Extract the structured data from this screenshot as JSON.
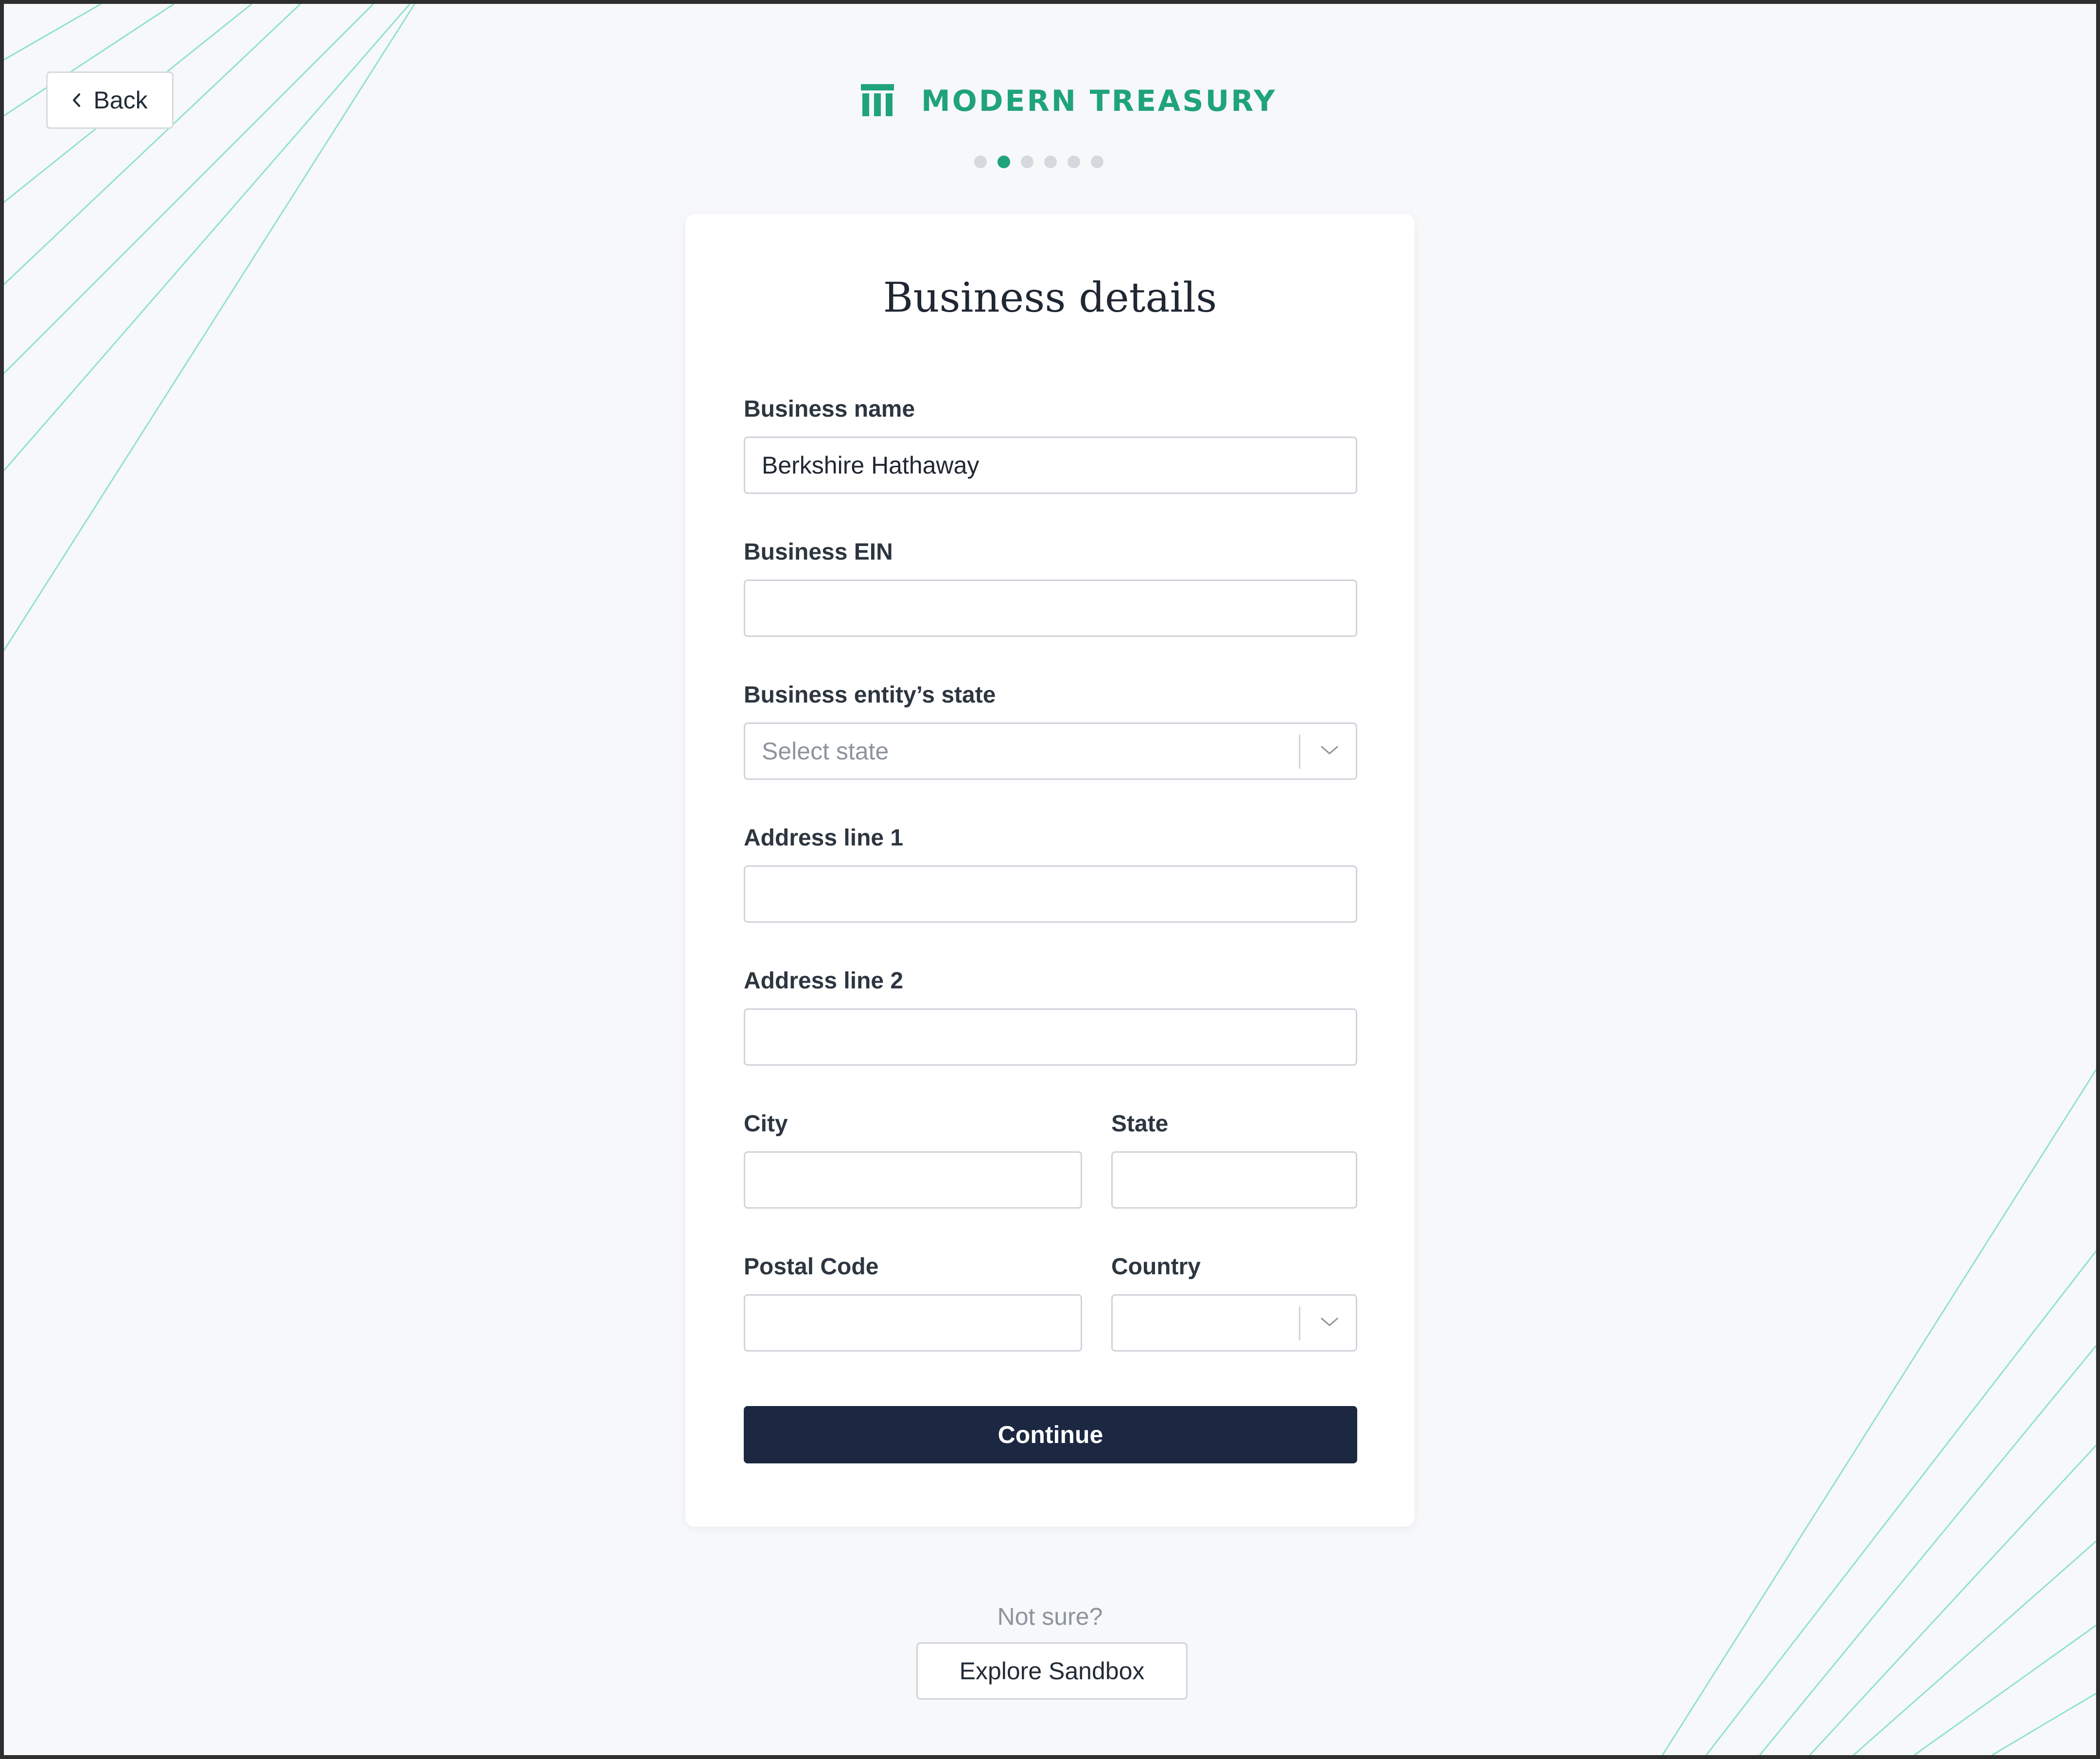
{
  "nav": {
    "back_label": "Back",
    "back_icon": "chevron-left-icon"
  },
  "brand": {
    "name": "MODERN TREASURY",
    "logo_icon": "treasury-columns-logo",
    "color": "#1fa37a"
  },
  "progress": {
    "total_steps": 6,
    "current_step": 2
  },
  "form": {
    "title": "Business details",
    "business_name": {
      "label": "Business name",
      "value": "Berkshire Hathaway"
    },
    "business_ein": {
      "label": "Business EIN",
      "value": ""
    },
    "entity_state": {
      "label": "Business entity’s state",
      "placeholder": "Select state",
      "icon": "chevron-down-icon"
    },
    "address_line_1": {
      "label": "Address line 1",
      "value": ""
    },
    "address_line_2": {
      "label": "Address line 2",
      "value": ""
    },
    "city": {
      "label": "City",
      "value": ""
    },
    "state": {
      "label": "State",
      "value": ""
    },
    "postal_code": {
      "label": "Postal Code",
      "value": ""
    },
    "country": {
      "label": "Country",
      "value": "",
      "icon": "chevron-down-icon"
    },
    "continue_label": "Continue"
  },
  "footer": {
    "prompt": "Not sure?",
    "sandbox_label": "Explore Sandbox"
  },
  "colors": {
    "accent": "#1fa37a",
    "primary_button": "#1c2841",
    "background": "#f7f8fa",
    "decor_lines": "#8fe3c9"
  }
}
